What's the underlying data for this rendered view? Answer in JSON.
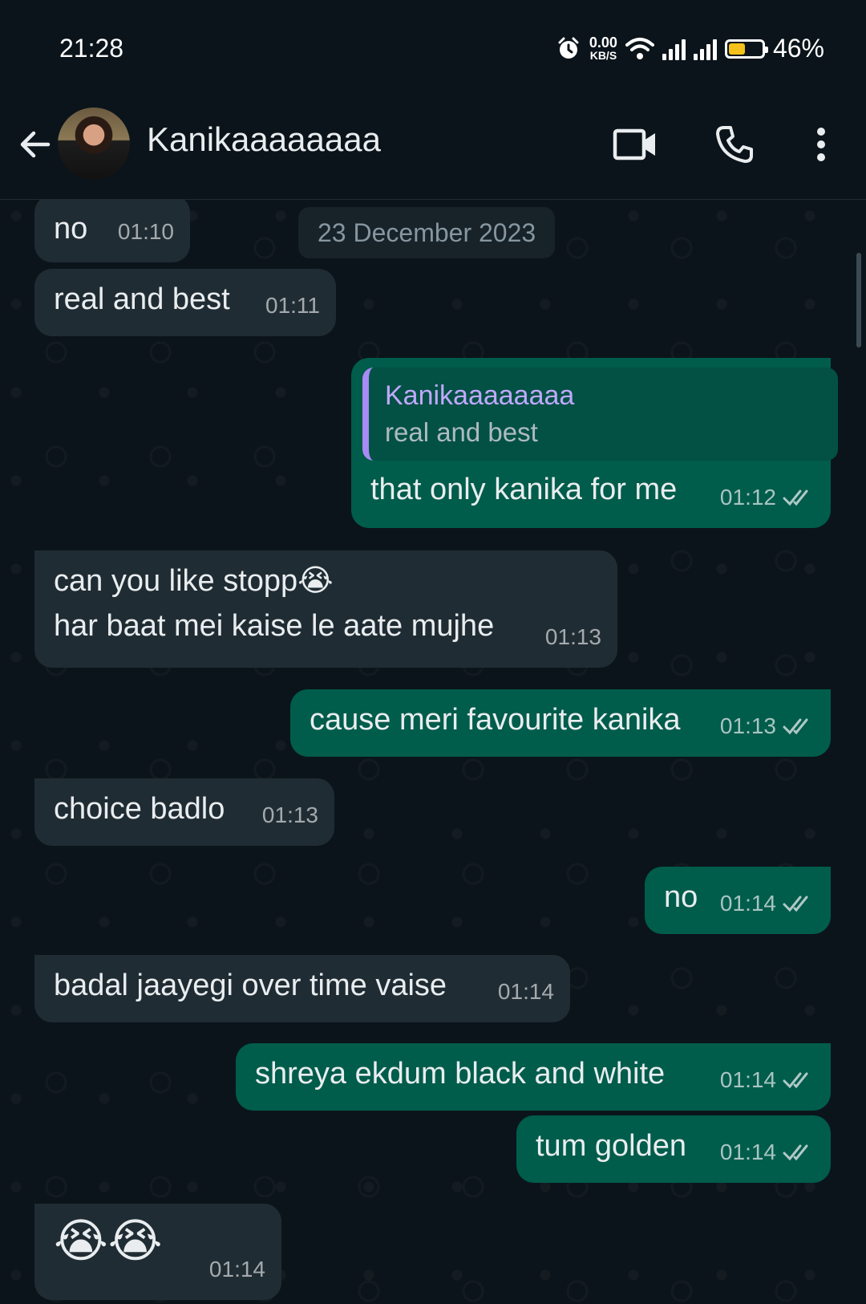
{
  "status_bar": {
    "time": "21:28",
    "net_speed": "0.00",
    "net_unit": "KB/S",
    "battery_percent": "46%",
    "battery_level": 0.46,
    "icons": [
      "alarm-icon",
      "wifi-icon",
      "signal-icon",
      "signal-icon",
      "battery-icon"
    ]
  },
  "header": {
    "contact_name": "Kanikaaaaaaaa",
    "icons": [
      "back-arrow-icon",
      "video-call-icon",
      "voice-call-icon",
      "more-options-icon"
    ]
  },
  "chat": {
    "date_separator": "23 December 2023",
    "messages": [
      {
        "direction": "in",
        "text": "no",
        "time": "01:10"
      },
      {
        "direction": "in",
        "text": "real and best",
        "time": "01:11"
      },
      {
        "direction": "out",
        "quoted_name": "Kanikaaaaaaaa",
        "quoted_text": "real and best",
        "text": "that only kanika for me",
        "time": "01:12",
        "status": "read"
      },
      {
        "direction": "in",
        "text": "can you like stopp😭\nhar baat mei kaise le aate mujhe",
        "time": "01:13"
      },
      {
        "direction": "out",
        "text": "cause meri favourite kanika",
        "time": "01:13",
        "status": "read"
      },
      {
        "direction": "in",
        "text": "choice badlo",
        "time": "01:13"
      },
      {
        "direction": "out",
        "text": "no",
        "time": "01:14",
        "status": "read"
      },
      {
        "direction": "in",
        "text": "badal jaayegi over time vaise",
        "time": "01:14"
      },
      {
        "direction": "out",
        "text": "shreya ekdum black and white",
        "time": "01:14",
        "status": "read"
      },
      {
        "direction": "out",
        "text": "tum golden",
        "time": "01:14",
        "status": "read"
      },
      {
        "direction": "in",
        "text": "😭😭",
        "time": "01:14"
      }
    ]
  },
  "colors": {
    "background": "#0b141a",
    "incoming_bubble": "#202c33",
    "outgoing_bubble": "#005c4b",
    "quote_bar": "#a88bf4",
    "battery_fill": "#f4c21a"
  }
}
